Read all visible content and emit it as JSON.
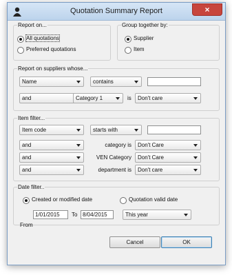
{
  "window": {
    "title": "Quotation Summary Report",
    "close_glyph": "×"
  },
  "report_on": {
    "legend": "Report on...",
    "options": [
      {
        "label": "All quotations",
        "selected": true
      },
      {
        "label": "Preferred quotations",
        "selected": false
      }
    ]
  },
  "group_by": {
    "legend": "Group together by:",
    "options": [
      {
        "label": "Supplier",
        "selected": true
      },
      {
        "label": "Item",
        "selected": false
      }
    ]
  },
  "supplier_filter": {
    "legend": "Report on suppliers whose...",
    "field": "Name",
    "operator": "contains",
    "value": "",
    "conjunction": "and",
    "category_field": "Category 1",
    "is_label": "is",
    "category_value": "Don't care"
  },
  "item_filter": {
    "legend": "Item filter...",
    "field": "Item code",
    "operator": "starts with",
    "value": "",
    "rows": [
      {
        "conjunction": "and",
        "label": "category is",
        "value": "Don't Care"
      },
      {
        "conjunction": "and",
        "label": "VEN Category",
        "value": "Don't Care"
      },
      {
        "conjunction": "and",
        "label": "department is",
        "value": "Don't care"
      }
    ]
  },
  "date_filter": {
    "legend": "Date filter..",
    "options": [
      {
        "label": "Created or modified date",
        "selected": true
      },
      {
        "label": "Quotation valid date",
        "selected": false
      }
    ],
    "from_date": "1/01/2015",
    "to_label": "To",
    "to_date": "8/04/2015",
    "period": "This year",
    "from_label": "From"
  },
  "buttons": {
    "cancel": "Cancel",
    "ok": "OK"
  }
}
